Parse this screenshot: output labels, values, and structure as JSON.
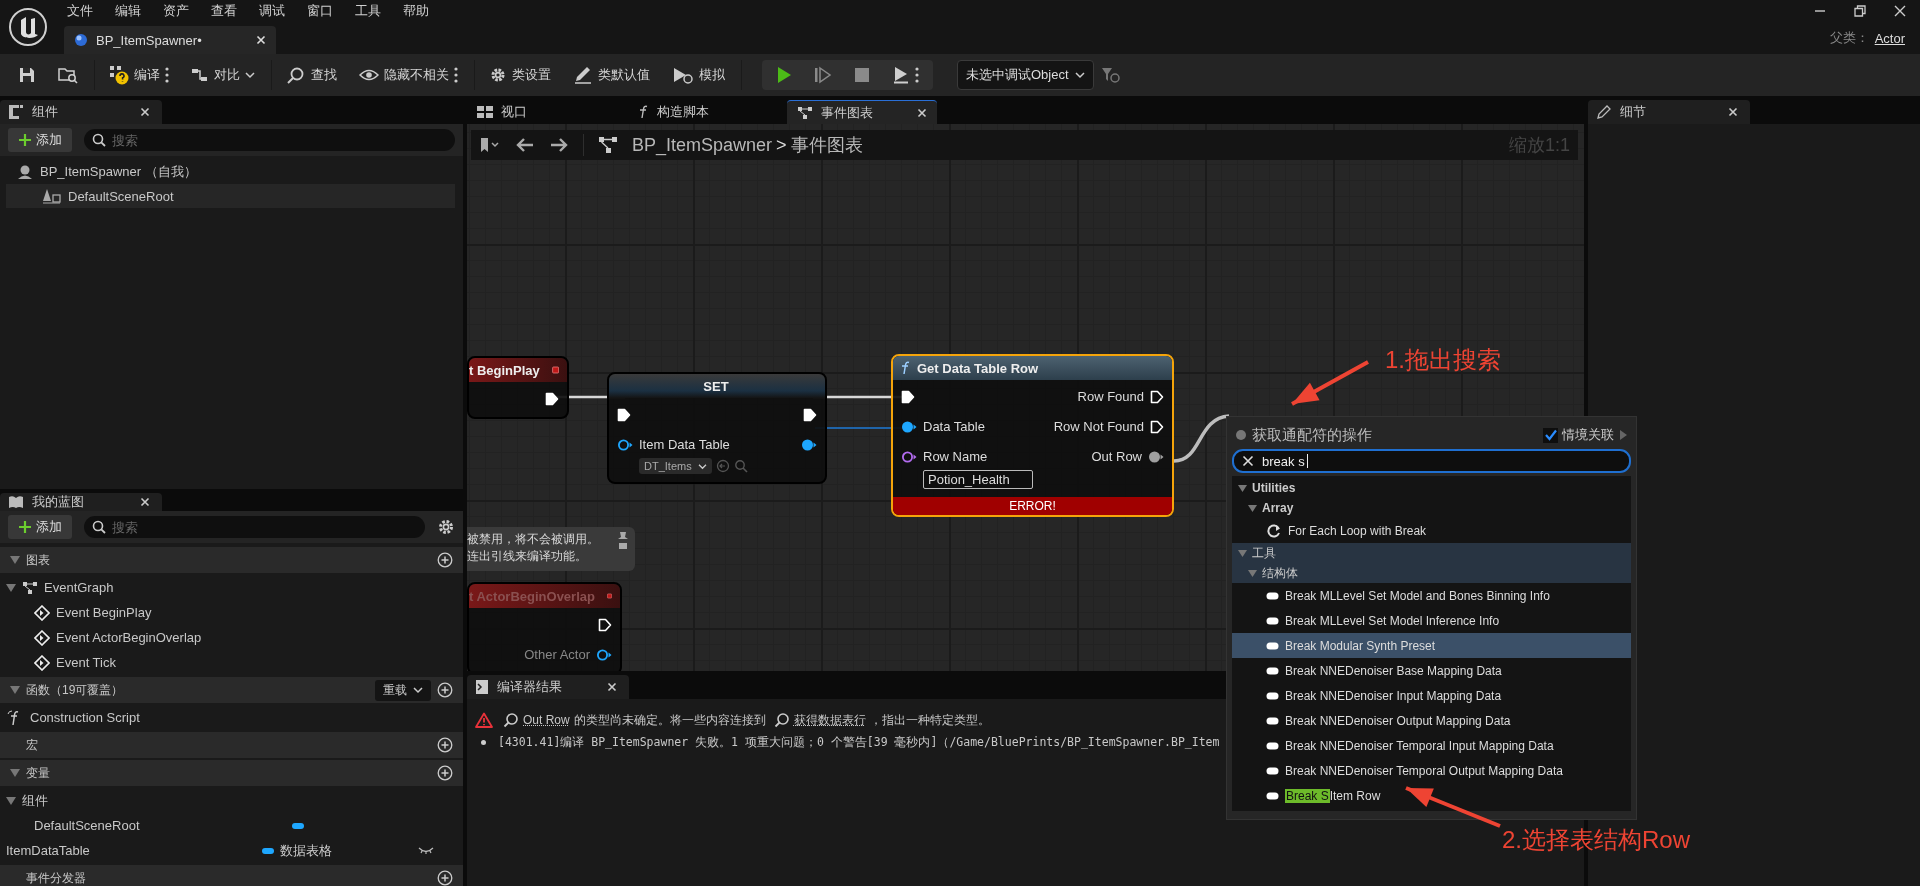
{
  "menu_bar": {
    "items": [
      "文件",
      "编辑",
      "资产",
      "查看",
      "调试",
      "窗口",
      "工具",
      "帮助"
    ]
  },
  "document_tabs": [
    {
      "label": "BP_ItemSpawner•",
      "selected": true
    }
  ],
  "parent_class": {
    "label": "父类：",
    "value": "Actor"
  },
  "toolbar": {
    "groups": [
      {
        "kind": "tools",
        "buttons": [
          {
            "kind": "save"
          },
          {
            "kind": "browse"
          }
        ]
      },
      {
        "kind": "tools",
        "buttons": [
          {
            "kind": "compile",
            "label": "编译",
            "menu": true
          },
          {
            "kind": "diff",
            "label": "对比",
            "dropdown": true
          }
        ]
      },
      {
        "kind": "tools",
        "buttons": [
          {
            "kind": "find",
            "label": "查找"
          },
          {
            "kind": "hide",
            "label": "隐藏不相关",
            "menu": true
          }
        ]
      },
      {
        "kind": "tools",
        "buttons": [
          {
            "kind": "class_settings",
            "label": "类设置"
          },
          {
            "kind": "class_defaults",
            "label": "类默认值"
          },
          {
            "kind": "simulate",
            "label": "模拟"
          }
        ]
      },
      {
        "kind": "playback",
        "buttons": [
          {
            "kind": "play"
          },
          {
            "kind": "step"
          },
          {
            "kind": "stop"
          },
          {
            "kind": "eject",
            "menu": true
          }
        ]
      }
    ],
    "debug_object": {
      "value": "未选中调试Object"
    }
  },
  "components_panel": {
    "title": "组件",
    "add_button": "添加",
    "search": {
      "placeholder": "搜索"
    },
    "tree": [
      {
        "label": "BP_ItemSpawner （自我）",
        "kind": "actor",
        "selected": false,
        "children": [
          {
            "label": "DefaultSceneRoot",
            "kind": "scene",
            "selected": true
          }
        ]
      }
    ]
  },
  "my_blueprint_panel": {
    "title": "我的蓝图",
    "add_button": "添加",
    "search": {
      "placeholder": "搜索"
    },
    "sections": [
      {
        "title": "图表",
        "items": [
          {
            "label": "EventGraph",
            "kind": "graph",
            "children": [
              {
                "label": "Event BeginPlay",
                "kind": "event"
              },
              {
                "label": "Event ActorBeginOverlap",
                "kind": "event"
              },
              {
                "label": "Event Tick",
                "kind": "event"
              }
            ]
          }
        ]
      },
      {
        "title": "函数（19可覆盖）",
        "override_button": "重载",
        "items": [
          {
            "label": "Construction Script",
            "kind": "function"
          }
        ]
      },
      {
        "title": "宏"
      },
      {
        "title": "变量",
        "items": [
          {
            "label": "组件",
            "kind": "category",
            "children": [
              {
                "label": "DefaultSceneRoot",
                "kind": "variable"
              }
            ]
          },
          {
            "label": "ItemDataTable",
            "kind": "variable",
            "type": "数据表格"
          }
        ]
      },
      {
        "title": "事件分发器"
      }
    ]
  },
  "editor_tabs": [
    {
      "label": "视口",
      "selected": false
    },
    {
      "label": "构造脚本",
      "selected": false
    },
    {
      "label": "事件图表",
      "selected": true
    }
  ],
  "breadcrumb": {
    "blueprint": "BP_ItemSpawner",
    "separator": ">",
    "graph": "事件图表"
  },
  "zoom_label": "缩放1:1",
  "graph": {
    "nodes": [
      {
        "kind": "event",
        "title": "t BeginPlay",
        "selected": false,
        "disabled": false,
        "outputs": [
          {
            "kind": "exec",
            "connected": true
          }
        ]
      },
      {
        "kind": "set",
        "title": "SET",
        "selected": false,
        "disabled": false,
        "inputs": [
          {
            "kind": "exec",
            "connected": true
          },
          {
            "kind": "data",
            "label": "Item Data Table",
            "color": "#1ea7ff",
            "connected": false,
            "dropdown": {
              "value": "DT_Items"
            }
          }
        ],
        "outputs": [
          {
            "kind": "exec",
            "connected": true
          },
          {
            "kind": "data",
            "color": "#1ea7ff",
            "connected": true
          }
        ]
      },
      {
        "kind": "function",
        "title": "Get Data Table Row",
        "selected": true,
        "disabled": false,
        "error": "ERROR!",
        "inputs": [
          {
            "kind": "exec",
            "connected": true
          },
          {
            "kind": "data",
            "label": "Data Table",
            "color": "#1ea7ff",
            "connected": true
          },
          {
            "kind": "data",
            "label": "Row Name",
            "color": "#b36cf0",
            "connected": false,
            "text_field": {
              "value": "Potion_Health"
            }
          }
        ],
        "outputs": [
          {
            "kind": "exec",
            "label": "Row Found",
            "connected": false
          },
          {
            "kind": "exec",
            "label": "Row Not Found",
            "connected": false
          },
          {
            "kind": "data",
            "label": "Out Row",
            "color": "#a0a0a0",
            "connected": true
          }
        ]
      },
      {
        "kind": "event",
        "title": "t ActorBeginOverlap",
        "selected": false,
        "disabled": true,
        "outputs": [
          {
            "kind": "exec",
            "connected": false
          },
          {
            "kind": "data",
            "label": "Other Actor",
            "color": "#1ea7ff",
            "connected": false
          }
        ]
      }
    ],
    "comment": {
      "lines": [
        "被禁用，将不会被调用。",
        "连出引线来编译功能。"
      ]
    }
  },
  "action_menu": {
    "title": "获取通配符的操作",
    "context_sensitive": {
      "label": "情境关联",
      "checked": true
    },
    "search": {
      "value": "break s"
    },
    "categories": [
      {
        "label": "Utilities",
        "highlighted": false,
        "children": [
          {
            "label": "Array",
            "children": [
              {
                "label": "For Each Loop with Break",
                "kind": "macro",
                "selected": false
              }
            ]
          }
        ]
      },
      {
        "label": "工具",
        "highlighted": true,
        "children": [
          {
            "label": "结构体",
            "children": [
              {
                "label": "Break MLLevel Set Model and Bones Binning Info",
                "kind": "struct",
                "selected": false
              },
              {
                "label": "Break MLLevel Set Model Inference Info",
                "kind": "struct",
                "selected": false
              },
              {
                "label": "Break Modular Synth Preset",
                "kind": "struct",
                "selected": true
              },
              {
                "label": "Break NNEDenoiser Base Mapping Data",
                "kind": "struct",
                "selected": false
              },
              {
                "label": "Break NNEDenoiser Input Mapping Data",
                "kind": "struct",
                "selected": false
              },
              {
                "label": "Break NNEDenoiser Output Mapping Data",
                "kind": "struct",
                "selected": false
              },
              {
                "label": "Break NNEDenoiser Temporal Input Mapping Data",
                "kind": "struct",
                "selected": false
              },
              {
                "label": "Break NNEDenoiser Temporal Output Mapping Data",
                "kind": "struct",
                "selected": false
              },
              {
                "match": "Break S",
                "label": "Item Row",
                "kind": "struct",
                "selected": false
              }
            ]
          }
        ]
      }
    ]
  },
  "compiler_results": {
    "title": "编译器结果",
    "messages": [
      {
        "kind": "error",
        "segments": [
          {
            "kind": "link",
            "text": "Out Row"
          },
          {
            "kind": "text",
            "text": "的类型尚未确定。将一些内容连接到"
          },
          {
            "kind": "link",
            "text": "获得数据表行"
          },
          {
            "kind": "text",
            "text": "，指出一种特定类型。"
          }
        ]
      },
      {
        "kind": "info",
        "segments": [
          {
            "kind": "text",
            "text": "[4301.41]编译 BP_ItemSpawner 失败。1 项重大问题；0 个警告[39 毫秒内]（/Game/BluePrints/BP_ItemSpawner.BP_Item"
          }
        ]
      }
    ]
  },
  "details_panel": {
    "title": "细节"
  },
  "annotations": [
    {
      "text": "1.拖出搜索"
    },
    {
      "text": "2.选择表结构Row"
    }
  ]
}
